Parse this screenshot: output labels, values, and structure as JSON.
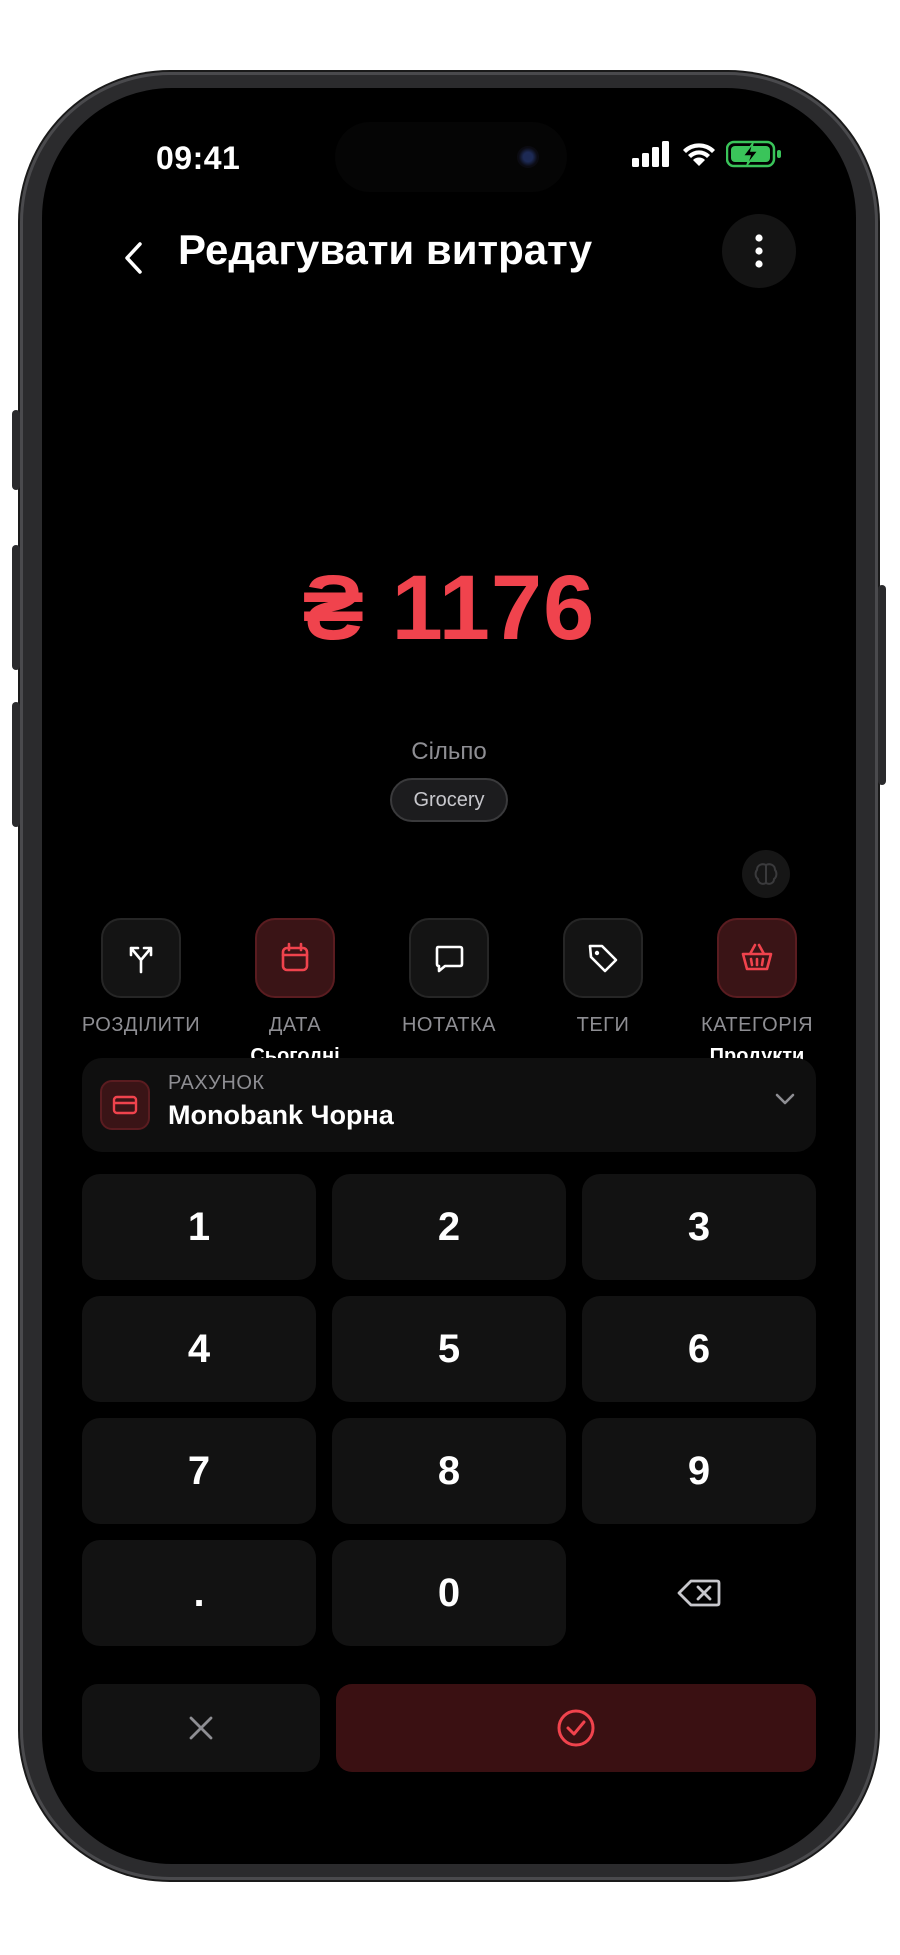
{
  "status_bar": {
    "time": "09:41"
  },
  "header": {
    "title": "Редагувати витрату"
  },
  "amount": {
    "currency_symbol": "₴",
    "value": "1176"
  },
  "merchant": "Сільпо",
  "category_chip": "Grocery",
  "actions": [
    {
      "label": "РОЗДІЛИТИ",
      "value": "",
      "icon": "split-icon",
      "active": false
    },
    {
      "label": "ДАТА",
      "value": "Сьогодні",
      "icon": "calendar-icon",
      "active": true
    },
    {
      "label": "НОТАТКА",
      "value": "",
      "icon": "note-icon",
      "active": false
    },
    {
      "label": "ТЕГИ",
      "value": "",
      "icon": "tag-icon",
      "active": false
    },
    {
      "label": "КАТЕГОРІЯ",
      "value": "Продукти",
      "icon": "basket-icon",
      "active": true
    }
  ],
  "account": {
    "label": "РАХУНОК",
    "name": "Monobank Чорна"
  },
  "keypad": {
    "keys": [
      "1",
      "2",
      "3",
      "4",
      "5",
      "6",
      "7",
      "8",
      "9",
      ".",
      "0",
      "backspace"
    ]
  },
  "colors": {
    "accent": "#f0434d",
    "background": "#000000",
    "surface": "#121212",
    "accent_dark": "#3a1012"
  }
}
